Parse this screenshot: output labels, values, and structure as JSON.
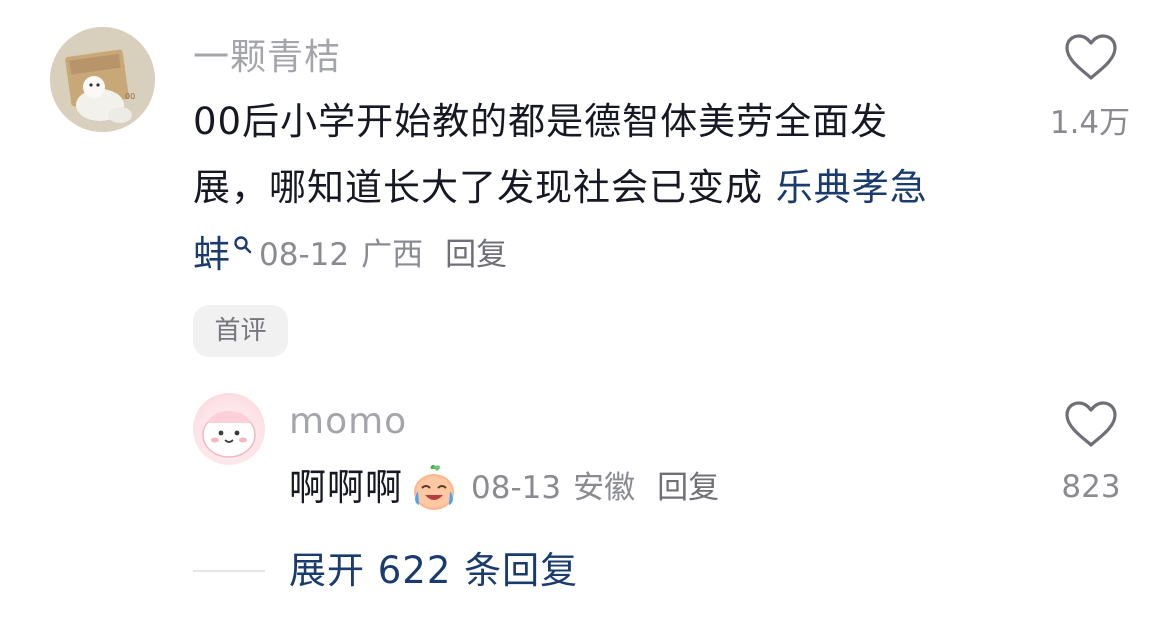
{
  "comment": {
    "username": "一颗青桔",
    "text": "00后小学开始教的都是德智体美劳全面发展，哪知道长大了发现社会已变成",
    "text_line1": "00后小学开始教的都是德智体美劳全面发",
    "text_line2": "展，哪知道长大了发现社会已变成",
    "link_part1": "乐典孝急",
    "link_part2": "蚌",
    "date": "08-12",
    "location": "广西",
    "reply_label": "回复",
    "likes": "1.4万",
    "badge": "首评"
  },
  "reply": {
    "username": "momo",
    "text": "啊啊啊",
    "date": "08-13",
    "location": "安徽",
    "reply_label": "回复",
    "likes": "823"
  },
  "expand": {
    "label": "展开 622 条回复"
  },
  "colors": {
    "link": "#1a3b6e",
    "meta": "#8a8b91",
    "username": "#a4a5ab",
    "text": "#161823"
  }
}
